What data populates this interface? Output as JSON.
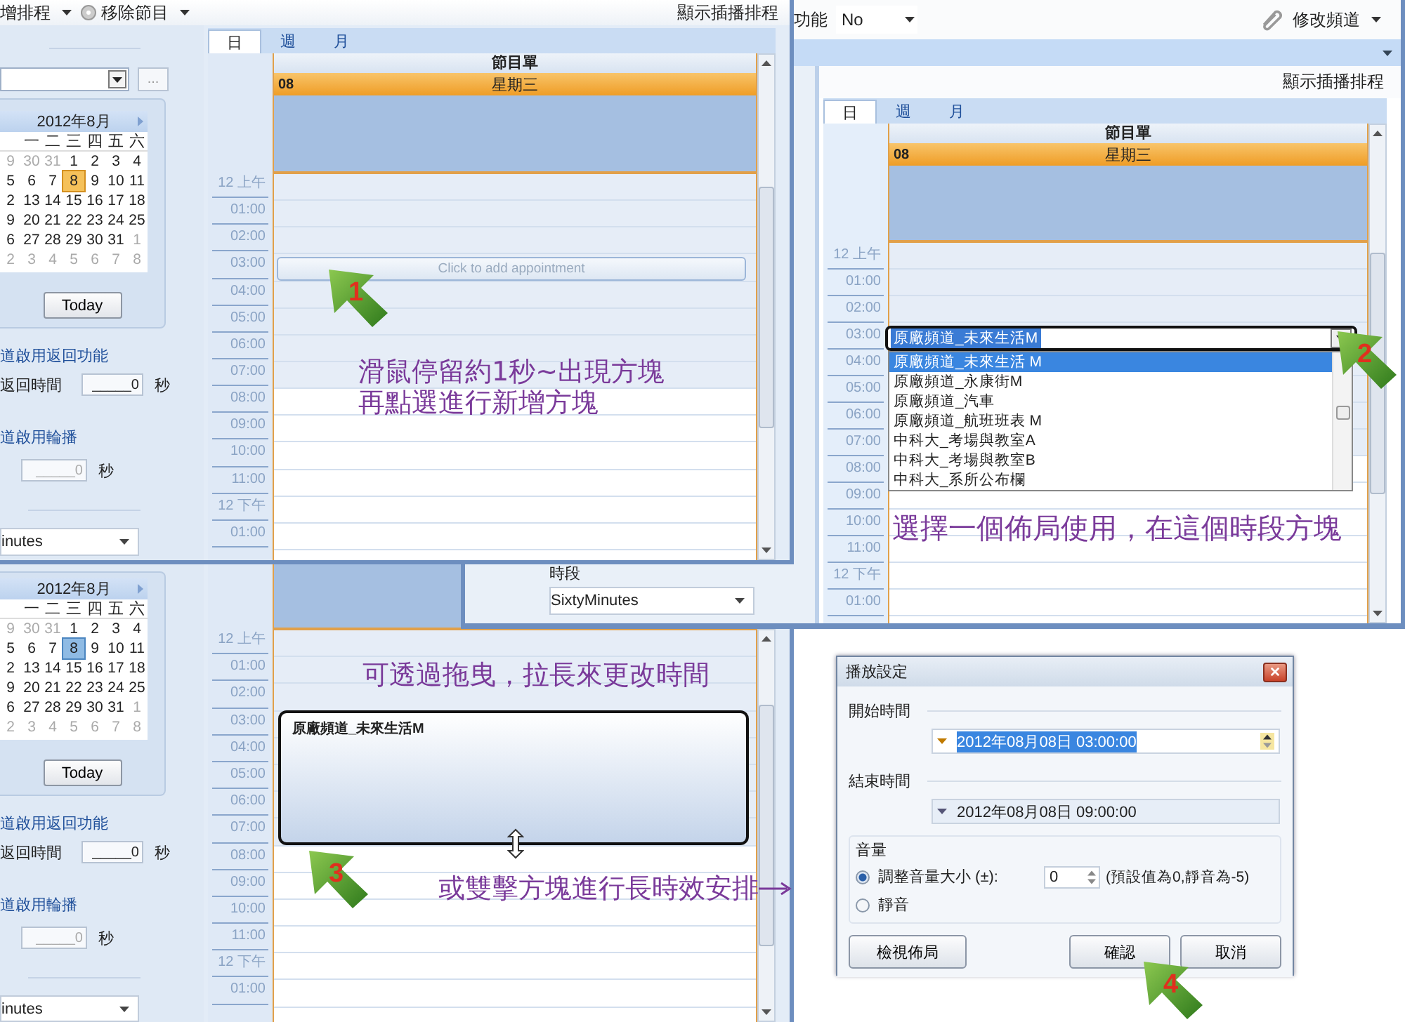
{
  "window_2": {
    "sidebar": {
      "calendar": {
        "title": "2012年8月",
        "weekdays": [
          "一",
          "二",
          "三",
          "四",
          "五",
          "六"
        ],
        "days": [
          {
            "day": "9",
            "other_month": true,
            "selected": false
          },
          {
            "day": "30",
            "other_month": true,
            "selected": false
          },
          {
            "day": "31",
            "other_month": true,
            "selected": false
          },
          {
            "day": "1",
            "other_month": false,
            "selected": false
          },
          {
            "day": "2",
            "other_month": false,
            "selected": false
          },
          {
            "day": "3",
            "other_month": false,
            "selected": false
          },
          {
            "day": "4",
            "other_month": false,
            "selected": false
          },
          {
            "day": "5",
            "other_month": false,
            "selected": false
          },
          {
            "day": "6",
            "other_month": false,
            "selected": false
          },
          {
            "day": "7",
            "other_month": false,
            "selected": false
          },
          {
            "day": "8",
            "other_month": false,
            "selected": true
          },
          {
            "day": "9",
            "other_month": false,
            "selected": false
          },
          {
            "day": "10",
            "other_month": false,
            "selected": false
          },
          {
            "day": "11",
            "other_month": false,
            "selected": false
          },
          {
            "day": "2",
            "other_month": false,
            "selected": false
          },
          {
            "day": "13",
            "other_month": false,
            "selected": false
          },
          {
            "day": "14",
            "other_month": false,
            "selected": false
          },
          {
            "day": "15",
            "other_month": false,
            "selected": false
          },
          {
            "day": "16",
            "other_month": false,
            "selected": false
          },
          {
            "day": "17",
            "other_month": false,
            "selected": false
          },
          {
            "day": "18",
            "other_month": false,
            "selected": false
          },
          {
            "day": "9",
            "other_month": false,
            "selected": false
          },
          {
            "day": "20",
            "other_month": false,
            "selected": false
          },
          {
            "day": "21",
            "other_month": false,
            "selected": false
          },
          {
            "day": "22",
            "other_month": false,
            "selected": false
          },
          {
            "day": "23",
            "other_month": false,
            "selected": false
          },
          {
            "day": "24",
            "other_month": false,
            "selected": false
          },
          {
            "day": "25",
            "other_month": false,
            "selected": false
          },
          {
            "day": "6",
            "other_month": false,
            "selected": false
          },
          {
            "day": "27",
            "other_month": false,
            "selected": false
          },
          {
            "day": "28",
            "other_month": false,
            "selected": false
          },
          {
            "day": "29",
            "other_month": false,
            "selected": false
          },
          {
            "day": "30",
            "other_month": false,
            "selected": false
          },
          {
            "day": "31",
            "other_month": false,
            "selected": false
          },
          {
            "day": "1",
            "other_month": true,
            "selected": false
          },
          {
            "day": "2",
            "other_month": true,
            "selected": false
          },
          {
            "day": "3",
            "other_month": true,
            "selected": false
          },
          {
            "day": "4",
            "other_month": true,
            "selected": false
          },
          {
            "day": "5",
            "other_month": true,
            "selected": false
          },
          {
            "day": "6",
            "other_month": true,
            "selected": false
          },
          {
            "day": "7",
            "other_month": true,
            "selected": false
          },
          {
            "day": "8",
            "other_month": true,
            "selected": false
          }
        ]
      },
      "today_button": "Today",
      "return_heading": "道啟用返回功能",
      "return_label": "返回時間",
      "return_value": "_____0",
      "return_unit": "秒",
      "rotation_heading": "道啟用輪播",
      "rotation_value": "_____0",
      "rotation_unit": "秒",
      "interval_value": "inutes"
    },
    "day_view": {
      "time_rows": [
        {
          "label": "12 上午",
          "working": false
        },
        {
          "label": "01:00",
          "working": false
        },
        {
          "label": "02:00",
          "working": false
        },
        {
          "label": "03:00",
          "working": false
        },
        {
          "label": "04:00",
          "working": false
        },
        {
          "label": "05:00",
          "working": false
        },
        {
          "label": "06:00",
          "working": false
        },
        {
          "label": "07:00",
          "working": false
        },
        {
          "label": "08:00",
          "working": true
        },
        {
          "label": "09:00",
          "working": true
        },
        {
          "label": "10:00",
          "working": true
        },
        {
          "label": "11:00",
          "working": true
        },
        {
          "label": "12 下午",
          "working": true
        },
        {
          "label": "01:00",
          "working": true
        }
      ]
    },
    "appointment": {
      "title": "原廠頻道_未來生活M"
    }
  },
  "window_3": {
    "toolbar": {
      "left_label": "功能",
      "select_value": "No",
      "right_button": "修改頻道"
    },
    "subbar": "顯示插播排程",
    "period_label": "時段",
    "period_value": "SixtyMinutes",
    "day_view": {
      "tabs": [
        {
          "label": "日",
          "selected": true
        },
        {
          "label": "週",
          "selected": false
        },
        {
          "label": "月",
          "selected": false
        }
      ],
      "column_header": "節目單",
      "day_number": "08",
      "day_name": "星期三",
      "time_rows": [
        {
          "label": "12 上午",
          "working": false
        },
        {
          "label": "01:00",
          "working": false
        },
        {
          "label": "02:00",
          "working": false
        },
        {
          "label": "03:00",
          "working": false
        },
        {
          "label": "04:00",
          "working": false
        },
        {
          "label": "05:00",
          "working": false
        },
        {
          "label": "06:00",
          "working": false
        },
        {
          "label": "07:00",
          "working": false
        },
        {
          "label": "08:00",
          "working": true
        },
        {
          "label": "09:00",
          "working": true
        },
        {
          "label": "10:00",
          "working": true
        },
        {
          "label": "11:00",
          "working": true
        },
        {
          "label": "12 下午",
          "working": true
        },
        {
          "label": "01:00",
          "working": true
        }
      ]
    },
    "layout_picker": {
      "value": "原廠頻道_未來生活M",
      "options": [
        {
          "label": "原廠頻道_未來生活 M",
          "selected": true
        },
        {
          "label": "原廠頻道_永康街M",
          "selected": false
        },
        {
          "label": "原廠頻道_汽車",
          "selected": false
        },
        {
          "label": "原廠頻道_航班班表 M",
          "selected": false
        },
        {
          "label": "中科大_考場與教室A",
          "selected": false
        },
        {
          "label": "中科大_考場與教室B",
          "selected": false
        },
        {
          "label": "中科大_系所公布欄",
          "selected": false
        }
      ]
    }
  },
  "window_1": {
    "toolbar": {
      "left": [
        {
          "label": "增排程"
        },
        {
          "label": "移除節目"
        }
      ],
      "right": "顯示插播排程"
    },
    "sidebar": {
      "browse_button": "...",
      "calendar": {
        "title": "2012年8月",
        "weekdays": [
          "一",
          "二",
          "三",
          "四",
          "五",
          "六"
        ],
        "days": [
          {
            "day": "9",
            "other_month": true,
            "selected": false
          },
          {
            "day": "30",
            "other_month": true,
            "selected": false
          },
          {
            "day": "31",
            "other_month": true,
            "selected": false
          },
          {
            "day": "1",
            "other_month": false,
            "selected": false
          },
          {
            "day": "2",
            "other_month": false,
            "selected": false
          },
          {
            "day": "3",
            "other_month": false,
            "selected": false
          },
          {
            "day": "4",
            "other_month": false,
            "selected": false
          },
          {
            "day": "5",
            "other_month": false,
            "selected": false
          },
          {
            "day": "6",
            "other_month": false,
            "selected": false
          },
          {
            "day": "7",
            "other_month": false,
            "selected": false
          },
          {
            "day": "8",
            "other_month": false,
            "selected": true
          },
          {
            "day": "9",
            "other_month": false,
            "selected": false
          },
          {
            "day": "10",
            "other_month": false,
            "selected": false
          },
          {
            "day": "11",
            "other_month": false,
            "selected": false
          },
          {
            "day": "2",
            "other_month": false,
            "selected": false
          },
          {
            "day": "13",
            "other_month": false,
            "selected": false
          },
          {
            "day": "14",
            "other_month": false,
            "selected": false
          },
          {
            "day": "15",
            "other_month": false,
            "selected": false
          },
          {
            "day": "16",
            "other_month": false,
            "selected": false
          },
          {
            "day": "17",
            "other_month": false,
            "selected": false
          },
          {
            "day": "18",
            "other_month": false,
            "selected": false
          },
          {
            "day": "9",
            "other_month": false,
            "selected": false
          },
          {
            "day": "20",
            "other_month": false,
            "selected": false
          },
          {
            "day": "21",
            "other_month": false,
            "selected": false
          },
          {
            "day": "22",
            "other_month": false,
            "selected": false
          },
          {
            "day": "23",
            "other_month": false,
            "selected": false
          },
          {
            "day": "24",
            "other_month": false,
            "selected": false
          },
          {
            "day": "25",
            "other_month": false,
            "selected": false
          },
          {
            "day": "6",
            "other_month": false,
            "selected": false
          },
          {
            "day": "27",
            "other_month": false,
            "selected": false
          },
          {
            "day": "28",
            "other_month": false,
            "selected": false
          },
          {
            "day": "29",
            "other_month": false,
            "selected": false
          },
          {
            "day": "30",
            "other_month": false,
            "selected": false
          },
          {
            "day": "31",
            "other_month": false,
            "selected": false
          },
          {
            "day": "1",
            "other_month": true,
            "selected": false
          },
          {
            "day": "2",
            "other_month": true,
            "selected": false
          },
          {
            "day": "3",
            "other_month": true,
            "selected": false
          },
          {
            "day": "4",
            "other_month": true,
            "selected": false
          },
          {
            "day": "5",
            "other_month": true,
            "selected": false
          },
          {
            "day": "6",
            "other_month": true,
            "selected": false
          },
          {
            "day": "7",
            "other_month": true,
            "selected": false
          },
          {
            "day": "8",
            "other_month": true,
            "selected": false
          }
        ]
      },
      "today_button": "Today",
      "return_heading": "道啟用返回功能",
      "return_label": "返回時間",
      "return_value": "_____0",
      "return_unit": "秒",
      "rotation_heading": "道啟用輪播",
      "rotation_value": "_____0",
      "rotation_unit": "秒",
      "interval_value": "inutes"
    },
    "day_view": {
      "tabs": [
        {
          "label": "日",
          "selected": true
        },
        {
          "label": "週",
          "selected": false
        },
        {
          "label": "月",
          "selected": false
        }
      ],
      "column_header": "節目單",
      "day_number": "08",
      "day_name": "星期三",
      "time_rows": [
        {
          "label": "12 上午",
          "working": false
        },
        {
          "label": "01:00",
          "working": false
        },
        {
          "label": "02:00",
          "working": false
        },
        {
          "label": "03:00",
          "working": false
        },
        {
          "label": "04:00",
          "working": false
        },
        {
          "label": "05:00",
          "working": false
        },
        {
          "label": "06:00",
          "working": false
        },
        {
          "label": "07:00",
          "working": false
        },
        {
          "label": "08:00",
          "working": true
        },
        {
          "label": "09:00",
          "working": true
        },
        {
          "label": "10:00",
          "working": true
        },
        {
          "label": "11:00",
          "working": true
        },
        {
          "label": "12 下午",
          "working": true
        },
        {
          "label": "01:00",
          "working": true
        }
      ]
    },
    "new_slot_hint": "Click to add appointment"
  },
  "dialog": {
    "title": "播放設定",
    "start_label": "開始時間",
    "start_value": "2012年08月08日 03:00:00",
    "end_label": "結束時間",
    "end_value": "2012年08月08日 09:00:00",
    "volume_group": "音量",
    "options": [
      {
        "label": "調整音量大小 (±):",
        "selected": true
      },
      {
        "label": "靜音",
        "selected": false
      }
    ],
    "volume_value": "0",
    "volume_hint": "(預設值為0,靜音為-5)",
    "buttons": [
      {
        "label": "檢視佈局"
      },
      {
        "label": "確認"
      },
      {
        "label": "取消"
      }
    ]
  },
  "annotations": [
    {
      "lines": [
        "滑鼠停留約1秒~出現方塊",
        "再點選進行新增方塊"
      ]
    },
    {
      "lines": [
        "選擇一個佈局使用，在這個時段方塊"
      ]
    },
    {
      "lines": [
        "可透過拖曳，拉長來更改時間"
      ]
    },
    {
      "lines": [
        "或雙擊方塊進行長時效安排"
      ]
    }
  ],
  "step_markers": [
    {
      "number": "1"
    },
    {
      "number": "2"
    },
    {
      "number": "3"
    },
    {
      "number": "4"
    }
  ]
}
